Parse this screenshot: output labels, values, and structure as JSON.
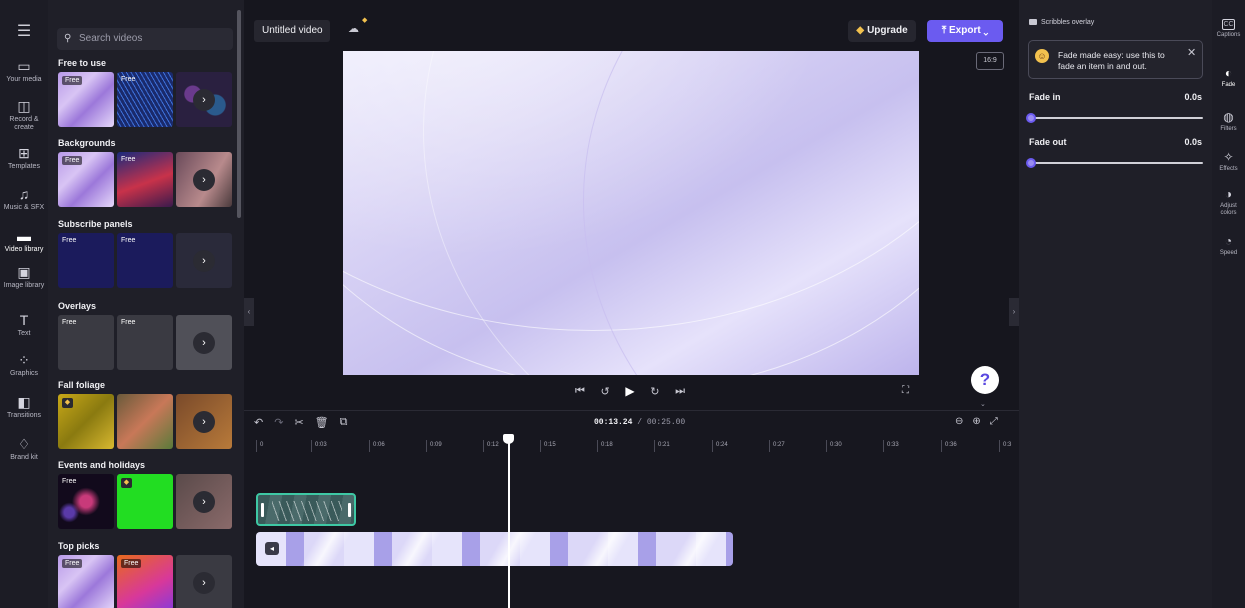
{
  "header": {
    "project_title": "Untitled video",
    "upgrade_label": "Upgrade",
    "export_label": "Export",
    "aspect_ratio": "16:9"
  },
  "left_rail": {
    "items": [
      {
        "label": "Your media",
        "icon": "folder-icon"
      },
      {
        "label": "Record & create",
        "icon": "camera-icon"
      },
      {
        "label": "Templates",
        "icon": "templates-icon"
      },
      {
        "label": "Music & SFX",
        "icon": "music-icon"
      },
      {
        "label": "Video library",
        "icon": "video-library-icon",
        "active": true
      },
      {
        "label": "Image library",
        "icon": "image-icon"
      },
      {
        "label": "Text",
        "icon": "text-icon"
      },
      {
        "label": "Graphics",
        "icon": "graphics-icon"
      },
      {
        "label": "Transitions",
        "icon": "transitions-icon"
      },
      {
        "label": "Brand kit",
        "icon": "brand-kit-icon"
      }
    ]
  },
  "library": {
    "search_placeholder": "Search videos",
    "free_badge": "Free",
    "sections": [
      {
        "title": "Free to use"
      },
      {
        "title": "Backgrounds"
      },
      {
        "title": "Subscribe panels"
      },
      {
        "title": "Overlays"
      },
      {
        "title": "Fall foliage"
      },
      {
        "title": "Events and holidays"
      },
      {
        "title": "Top picks"
      }
    ]
  },
  "player": {
    "current_time": "00:13.24",
    "duration": "/ 00:25.00"
  },
  "timeline": {
    "ticks": [
      "0",
      "0:03",
      "0:06",
      "0:09",
      "0:12",
      "0:15",
      "0:18",
      "0:21",
      "0:24",
      "0:27",
      "0:30",
      "0:33",
      "0:36",
      "0:3"
    ]
  },
  "properties": {
    "clip_name": "Scribbles overlay",
    "tip_text": "Fade made easy: use this to fade an item in and out.",
    "fade_in_label": "Fade in",
    "fade_in_value": "0.0s",
    "fade_out_label": "Fade out",
    "fade_out_value": "0.0s"
  },
  "right_rail": {
    "items": [
      {
        "label": "Captions",
        "icon": "captions-icon"
      },
      {
        "label": "Fade",
        "icon": "fade-icon",
        "active": true
      },
      {
        "label": "Filters",
        "icon": "filters-icon"
      },
      {
        "label": "Effects",
        "icon": "effects-icon"
      },
      {
        "label": "Adjust colors",
        "icon": "adjust-colors-icon"
      },
      {
        "label": "Speed",
        "icon": "speed-icon"
      }
    ]
  },
  "colors": {
    "accent": "#6b5bf0",
    "clip_outline": "#3ec8a4"
  }
}
